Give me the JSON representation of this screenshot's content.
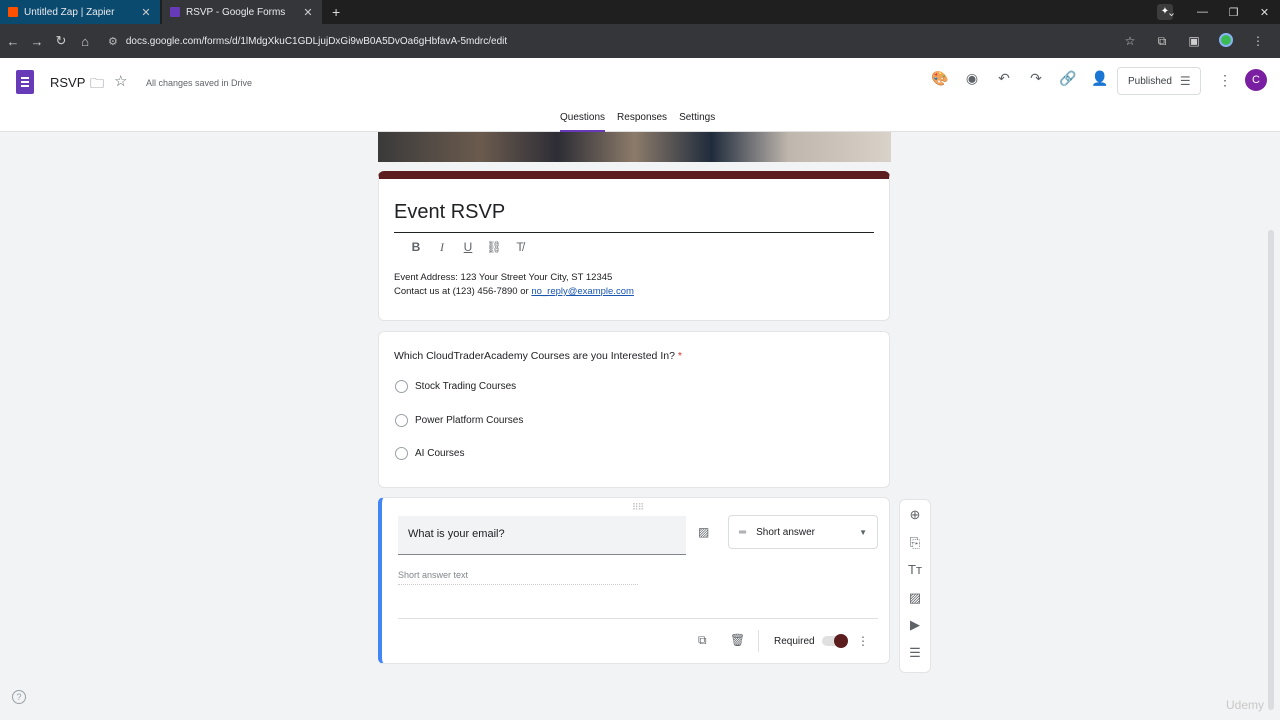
{
  "browser": {
    "tabs": [
      {
        "title": "Untitled Zap | Zapier",
        "favicon": "zapier-icon",
        "color": "#ff4f00"
      },
      {
        "title": "RSVP - Google Forms",
        "favicon": "google-forms-icon",
        "color": "#673ab7"
      }
    ],
    "url": "docs.google.com/forms/d/1lMdgXkuC1GDLjujDxGi9wB0A5DvOa6gHbfavA-5mdrc/edit"
  },
  "header": {
    "doc_title": "RSVP",
    "saved_status": "All changes saved in Drive",
    "publish_label": "Published",
    "avatar_letter": "C",
    "tabs": [
      "Questions",
      "Responses",
      "Settings"
    ],
    "active_tab": "Questions"
  },
  "form": {
    "title": "Event RSVP",
    "description_line1": "Event Address: 123 Your Street Your City, ST 12345",
    "description_line2": "Contact us at (123) 456-7890 or ",
    "contact_email": "no_reply@example.com",
    "accent_color": "#5b1d1d"
  },
  "question1": {
    "text": "Which CloudTraderAcademy Courses are you Interested In?",
    "required_mark": "*",
    "options": [
      "Stock Trading Courses",
      "Power Platform Courses",
      "AI Courses"
    ]
  },
  "question2": {
    "text": "What is your email?",
    "type": "Short answer",
    "placeholder": "Short answer text",
    "required_label": "Required",
    "required": true
  },
  "watermark": "Udemy"
}
